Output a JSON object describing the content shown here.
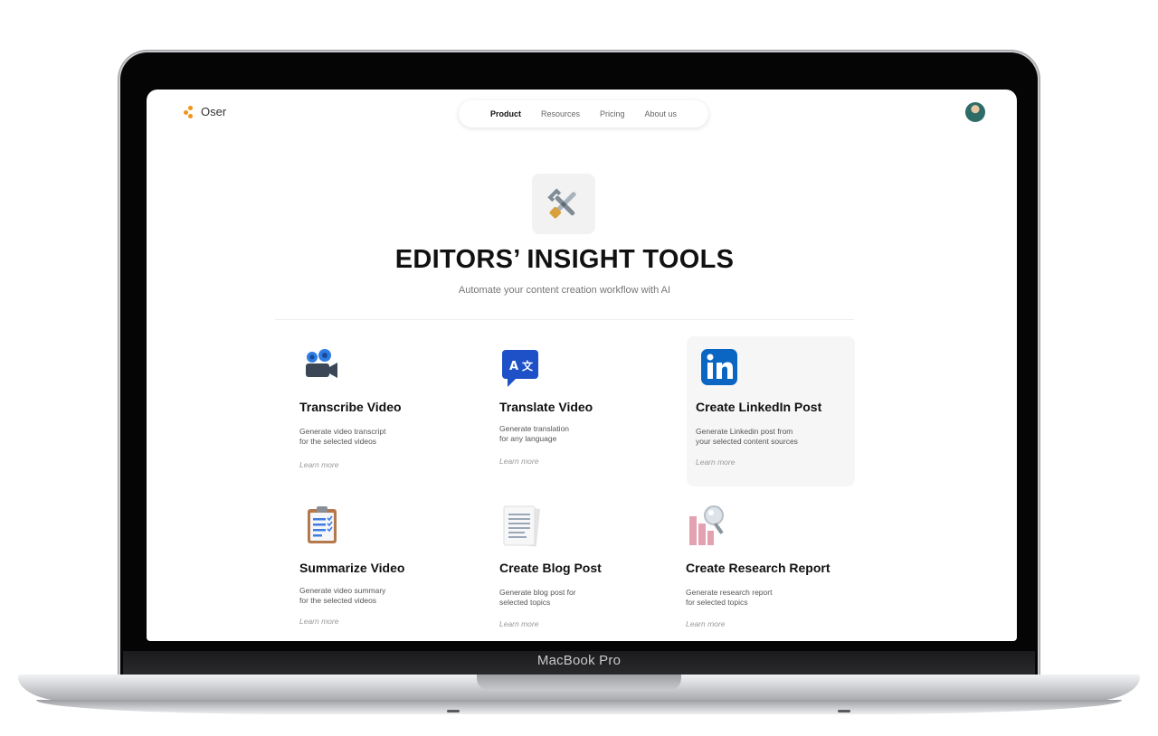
{
  "device": {
    "label": "MacBook Pro"
  },
  "app": {
    "brand": "Oser",
    "nav": [
      "Product",
      "Resources",
      "Pricing",
      "About us"
    ],
    "nav_active": 0
  },
  "hero": {
    "title": "EDITORS’ INSIGHT TOOLS",
    "subtitle": "Automate your content creation workflow with AI",
    "icon": "tools-wrench-screwdriver-icon"
  },
  "tools": [
    {
      "title": "Transcribe Video",
      "desc_1": "Generate video transcript",
      "desc_2": "for the selected videos",
      "link": "Learn more",
      "icon": "video-camera-icon"
    },
    {
      "title": "Translate Video",
      "desc_1": "Generate translation",
      "desc_2": "for any language",
      "link": "Learn more",
      "icon": "translate-icon"
    },
    {
      "title": "Create LinkedIn Post",
      "desc_1": "Generate Linkedin post from",
      "desc_2": "your selected content sources",
      "link": "Learn more",
      "icon": "linkedin-icon"
    },
    {
      "title": "Summarize Video",
      "desc_1": "Generate video summary",
      "desc_2": "for the selected videos",
      "link": "Learn more",
      "icon": "clipboard-icon"
    },
    {
      "title": "Create Blog Post",
      "desc_1": "Generate blog post for",
      "desc_2": "selected topics",
      "link": "Learn more",
      "icon": "document-icon"
    },
    {
      "title": "Create Research Report",
      "desc_1": "Generate research report",
      "desc_2": "for selected topics",
      "link": "Learn more",
      "icon": "research-chart-icon"
    }
  ],
  "colors": {
    "brand_accent": "#f29417",
    "linkedin_blue": "#0a66c2",
    "translate_blue": "#1e50c8",
    "highlight_card": "#f6f6f6"
  }
}
